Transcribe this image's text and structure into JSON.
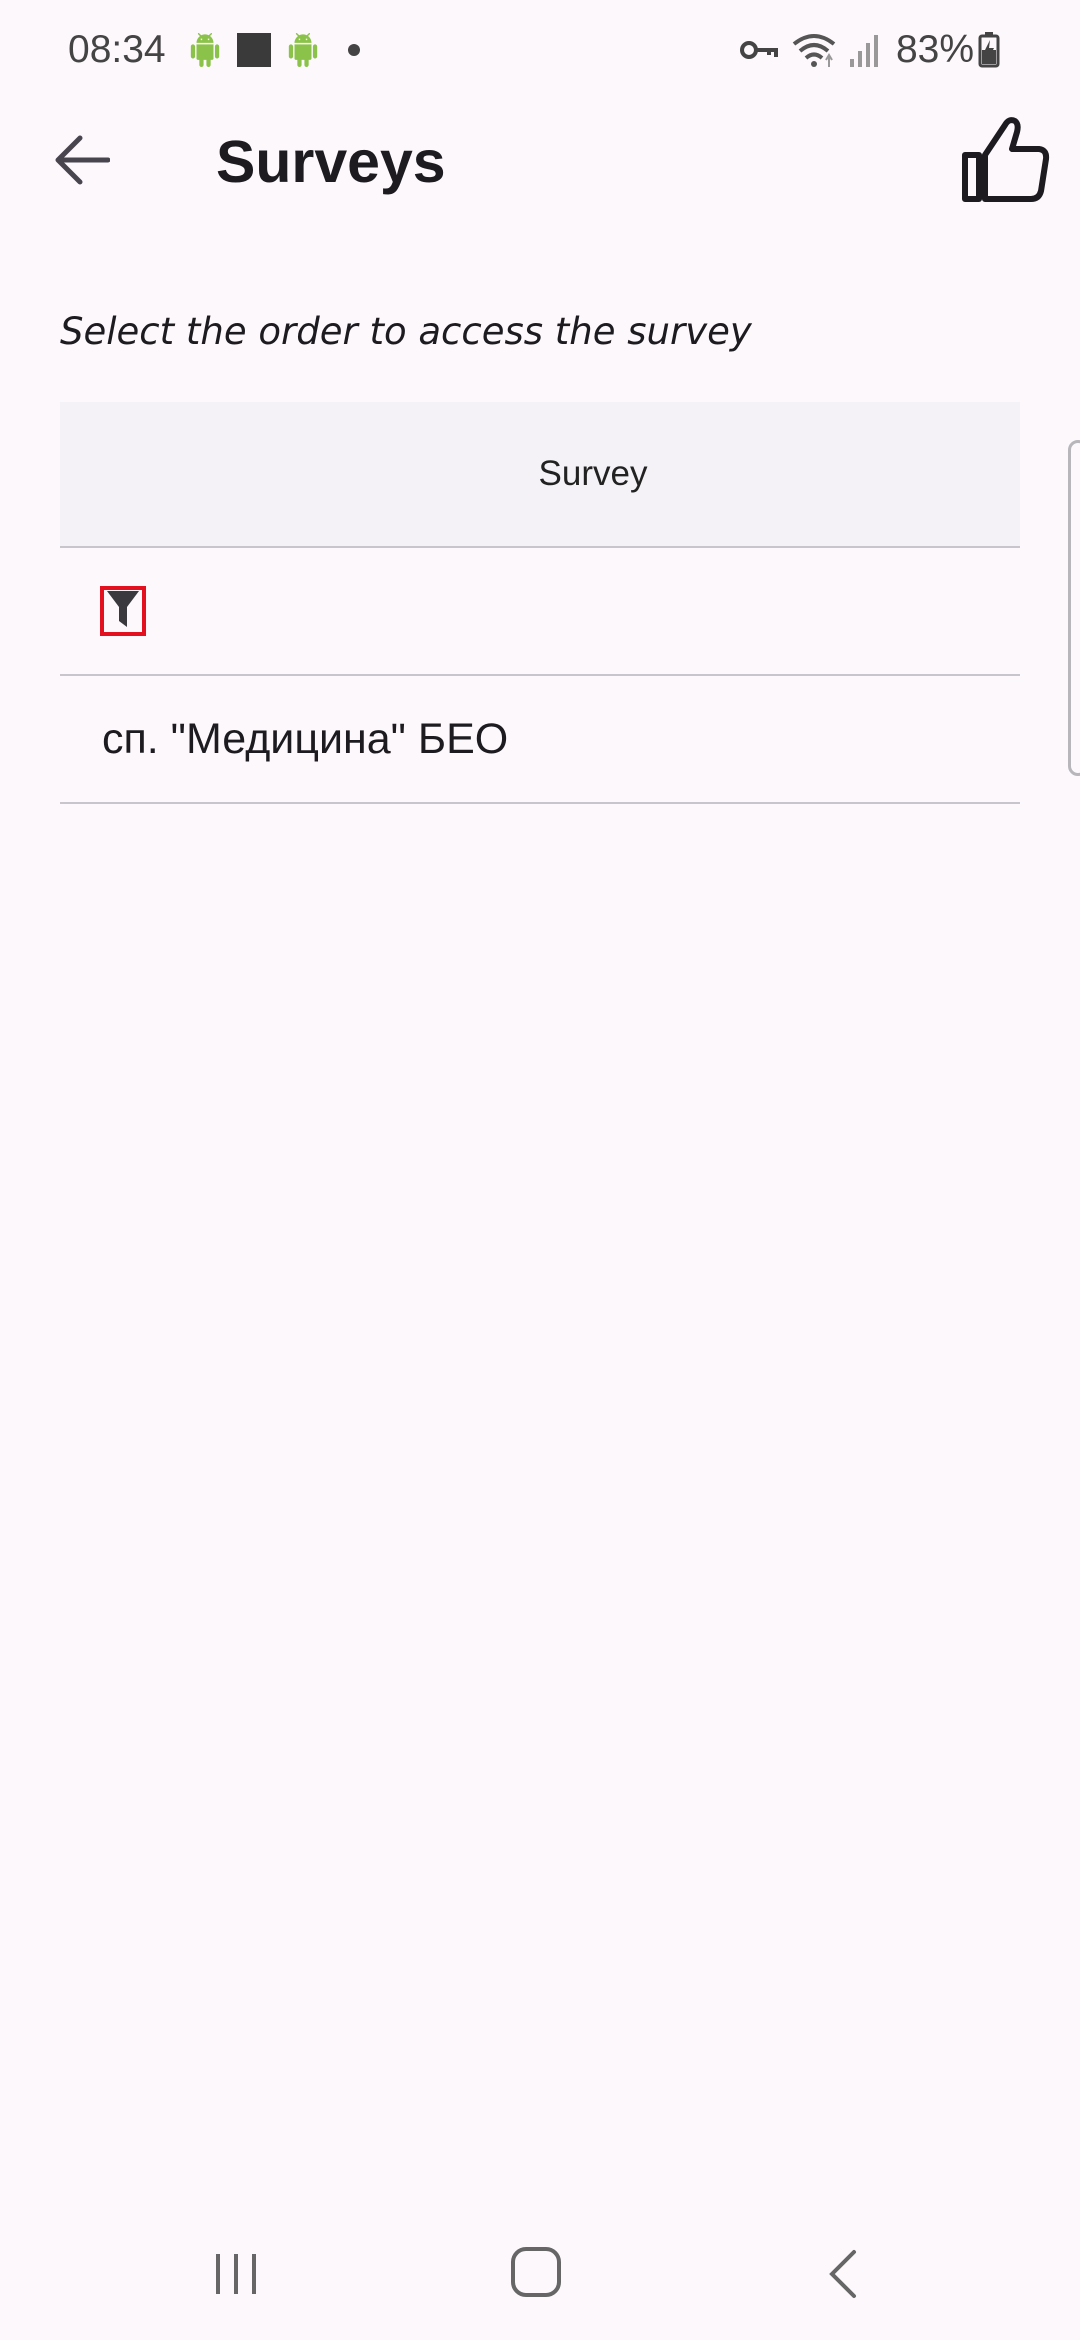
{
  "status_bar": {
    "time": "08:34",
    "battery_percent": "83%",
    "icons_left": [
      "android-icon",
      "square-icon",
      "android-icon",
      "notification-dot"
    ],
    "icons_right": [
      "vpn-key-icon",
      "wifi-icon",
      "signal-icon",
      "battery-charging-icon"
    ]
  },
  "app_bar": {
    "title": "Surveys",
    "back_icon": "arrow-left-icon",
    "action_icon": "thumbs-up-icon"
  },
  "instruction": "Select the order to access the survey",
  "table": {
    "header": "Survey",
    "filter_icon": "filter-icon",
    "rows": [
      {
        "label": "сп. \"Медицина\" БЕО"
      }
    ]
  },
  "nav_bar": {
    "icons": [
      "recents-icon",
      "home-icon",
      "back-icon"
    ]
  },
  "colors": {
    "background": "#fcf8fc",
    "header_background": "#f4f2f6",
    "divider": "#c8c5cc",
    "highlight_border": "#e3101f",
    "android_green": "#8bc34a"
  }
}
